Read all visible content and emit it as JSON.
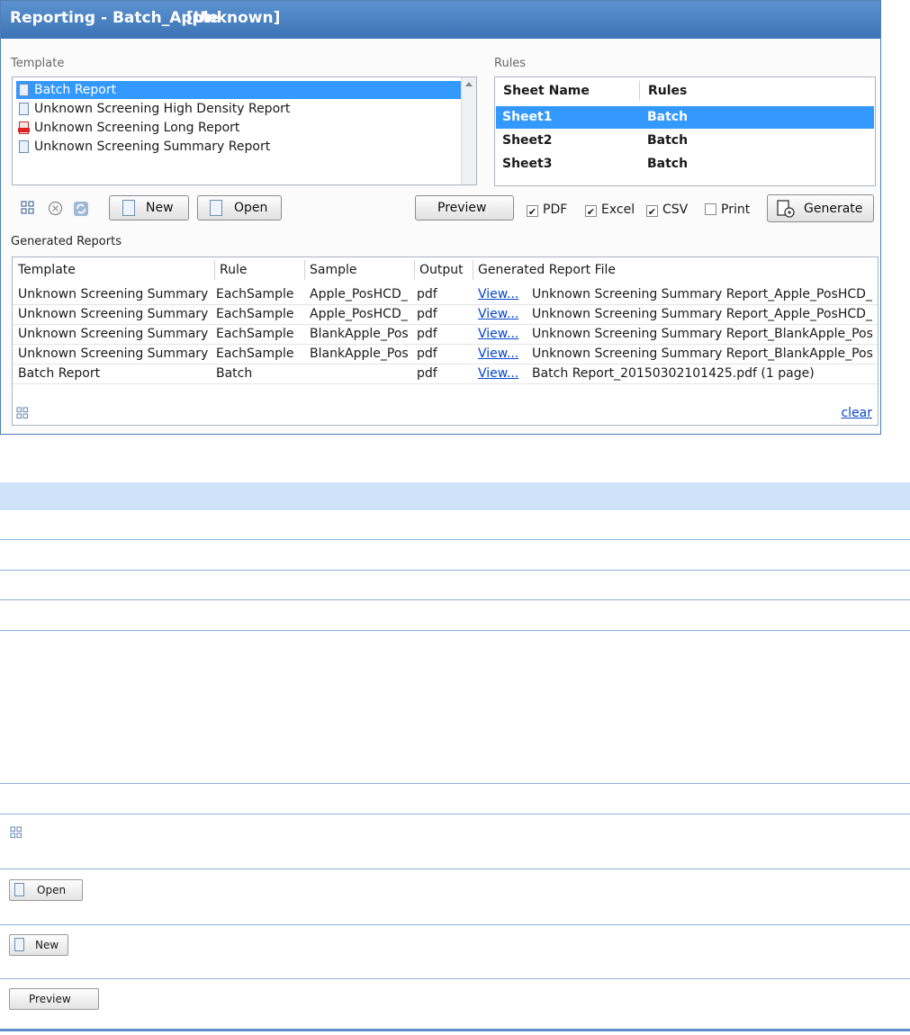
{
  "window": {
    "title": "Reporting - Batch_Apple",
    "title_suffix": "[Unknown]"
  },
  "template_section": {
    "label": "Template",
    "items": [
      {
        "label": "Batch Report",
        "icon": "report-template-icon",
        "selected": true
      },
      {
        "label": "Unknown Screening High Density Report",
        "icon": "report-template-icon"
      },
      {
        "label": "Unknown Screening Long Report",
        "icon": "pdf-icon"
      },
      {
        "label": "Unknown Screening Summary Report",
        "icon": "report-template-icon"
      }
    ]
  },
  "rules_section": {
    "label": "Rules",
    "columns": [
      "Sheet Name",
      "Rules"
    ],
    "rows": [
      {
        "sheet": "Sheet1",
        "rule": "Batch",
        "selected": true
      },
      {
        "sheet": "Sheet2",
        "rule": "Batch"
      },
      {
        "sheet": "Sheet3",
        "rule": "Batch"
      }
    ]
  },
  "toolbar": {
    "new_label": "New",
    "open_label": "Open",
    "preview_label": "Preview",
    "generate_label": "Generate",
    "checkboxes": [
      {
        "label": "PDF",
        "checked": true
      },
      {
        "label": "Excel",
        "checked": true
      },
      {
        "label": "CSV",
        "checked": true
      },
      {
        "label": "Print",
        "checked": false
      }
    ]
  },
  "generated_reports": {
    "label": "Generated Reports",
    "columns": [
      "Template",
      "Rule",
      "Sample",
      "Output",
      "Generated Report File"
    ],
    "view_label": "View...",
    "rows": [
      {
        "template": "Unknown Screening Summary",
        "rule": "EachSample",
        "sample": "Apple_PosHCD_",
        "output": "pdf",
        "file": "Unknown Screening Summary Report_Apple_PosHCD_"
      },
      {
        "template": "Unknown Screening Summary",
        "rule": "EachSample",
        "sample": "Apple_PosHCD_",
        "output": "pdf",
        "file": "Unknown Screening Summary Report_Apple_PosHCD_"
      },
      {
        "template": "Unknown Screening Summary",
        "rule": "EachSample",
        "sample": "BlankApple_Pos",
        "output": "pdf",
        "file": "Unknown Screening Summary Report_BlankApple_Pos"
      },
      {
        "template": "Unknown Screening Summary",
        "rule": "EachSample",
        "sample": "BlankApple_Pos",
        "output": "pdf",
        "file": "Unknown Screening Summary Report_BlankApple_Pos"
      },
      {
        "template": "Batch Report",
        "rule": "Batch",
        "sample": "",
        "output": "pdf",
        "file": "Batch Report_20150302101425.pdf (1 page)"
      }
    ],
    "clear_label": "clear"
  },
  "lower_table": {
    "open_label": "Open",
    "new_label": "New",
    "preview_label": "Preview"
  },
  "colors": {
    "title_bar": "#4a82c3",
    "selection": "#3399ff",
    "header_band": "#cfe2f7",
    "link": "#0645c8"
  }
}
